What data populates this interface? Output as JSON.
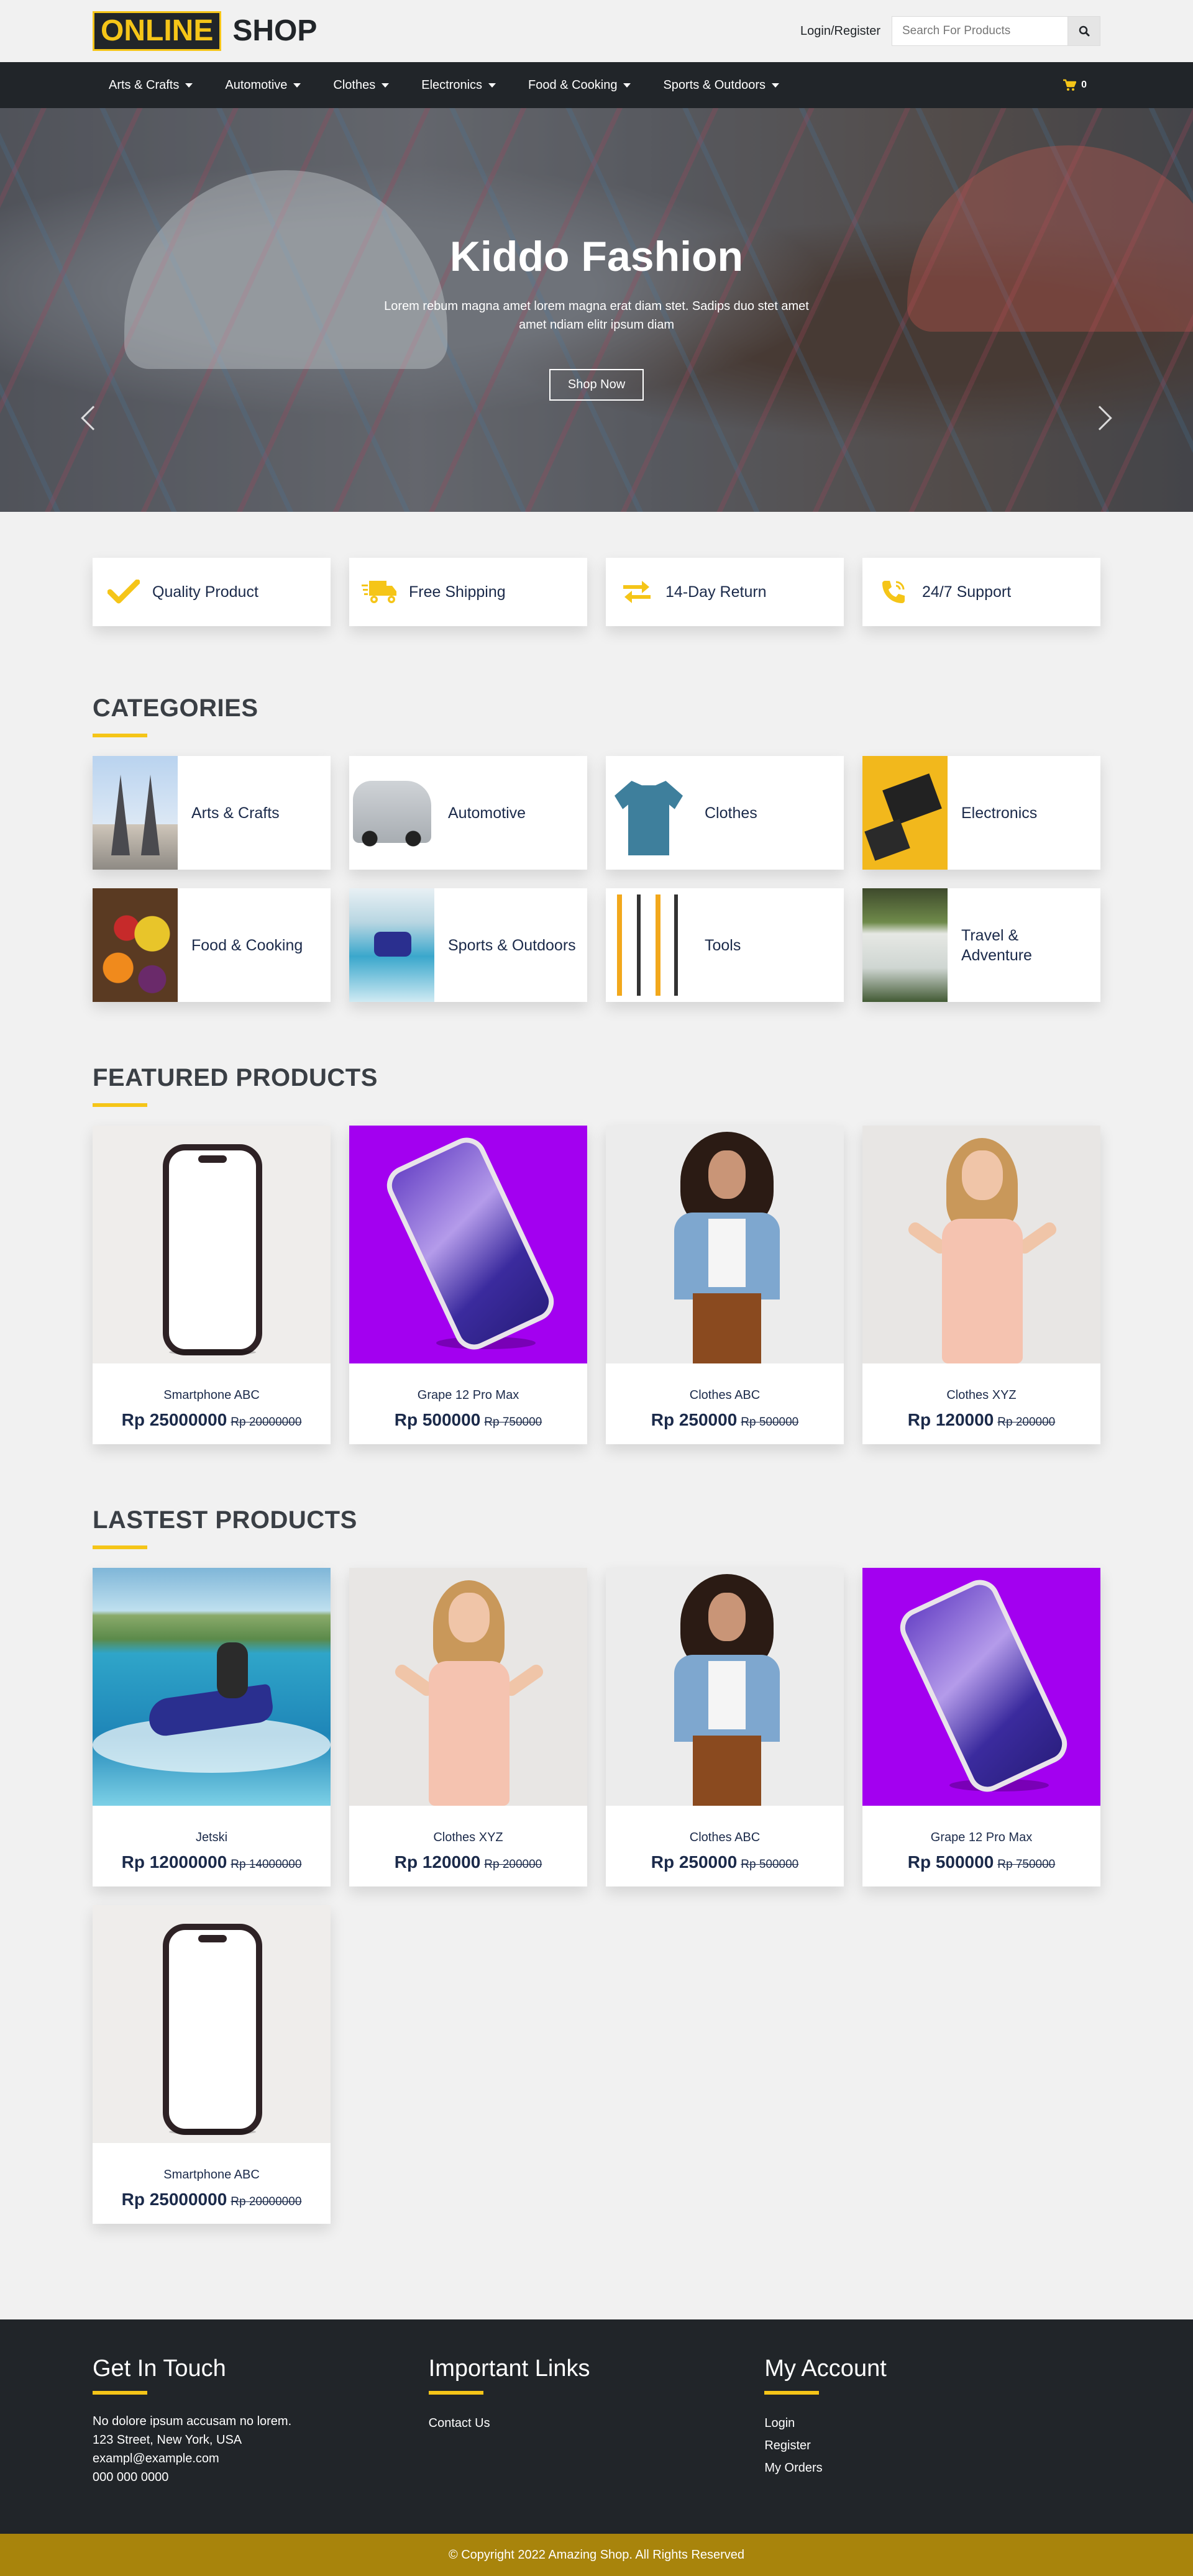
{
  "brand": {
    "part1": "ONLINE",
    "part2": "SHOP"
  },
  "header": {
    "login_label": "Login/Register",
    "search_placeholder": "Search For Products"
  },
  "nav": {
    "items": [
      {
        "label": "Arts & Crafts"
      },
      {
        "label": "Automotive"
      },
      {
        "label": "Clothes"
      },
      {
        "label": "Electronics"
      },
      {
        "label": "Food & Cooking"
      },
      {
        "label": "Sports & Outdoors"
      }
    ],
    "cart_count": "0"
  },
  "hero": {
    "title": "Kiddo Fashion",
    "text": "Lorem rebum magna amet lorem magna erat diam stet. Sadips duo stet amet amet ndiam elitr ipsum diam",
    "button_label": "Shop Now"
  },
  "features": [
    {
      "label": "Quality Product",
      "icon": "check-icon"
    },
    {
      "label": "Free Shipping",
      "icon": "truck-icon"
    },
    {
      "label": "14-Day Return",
      "icon": "exchange-icon"
    },
    {
      "label": "24/7 Support",
      "icon": "phone-icon"
    }
  ],
  "categories": {
    "title": "CATEGORIES",
    "items": [
      {
        "label": "Arts & Crafts"
      },
      {
        "label": "Automotive"
      },
      {
        "label": "Clothes"
      },
      {
        "label": "Electronics"
      },
      {
        "label": "Food & Cooking"
      },
      {
        "label": "Sports & Outdoors"
      },
      {
        "label": "Tools"
      },
      {
        "label": "Travel & Adventure"
      }
    ]
  },
  "featured": {
    "title": "FEATURED PRODUCTS",
    "items": [
      {
        "name": "Smartphone ABC",
        "price": "Rp 25000000",
        "old_price": "Rp 20000000"
      },
      {
        "name": "Grape 12 Pro Max",
        "price": "Rp 500000",
        "old_price": "Rp 750000"
      },
      {
        "name": "Clothes ABC",
        "price": "Rp 250000",
        "old_price": "Rp 500000"
      },
      {
        "name": "Clothes XYZ",
        "price": "Rp 120000",
        "old_price": "Rp 200000"
      }
    ]
  },
  "latest": {
    "title": "LASTEST PRODUCTS",
    "items": [
      {
        "name": "Jetski",
        "price": "Rp 12000000",
        "old_price": "Rp 14000000"
      },
      {
        "name": "Clothes XYZ",
        "price": "Rp 120000",
        "old_price": "Rp 200000"
      },
      {
        "name": "Clothes ABC",
        "price": "Rp 250000",
        "old_price": "Rp 500000"
      },
      {
        "name": "Grape 12 Pro Max",
        "price": "Rp 500000",
        "old_price": "Rp 750000"
      },
      {
        "name": "Smartphone ABC",
        "price": "Rp 25000000",
        "old_price": "Rp 20000000"
      }
    ]
  },
  "footer": {
    "contact": {
      "title": "Get In Touch",
      "lines": [
        "No dolore ipsum accusam no lorem.",
        "123 Street, New York, USA",
        "exampl@example.com",
        "000 000 0000"
      ]
    },
    "links": {
      "title": "Important Links",
      "items": [
        "Contact Us"
      ]
    },
    "account": {
      "title": "My Account",
      "items": [
        "Login",
        "Register",
        "My Orders"
      ]
    },
    "copyright": "© Copyright 2022 Amazing Shop. All Rights Reserved"
  },
  "colors": {
    "accent": "#f5c518",
    "dark": "#212529",
    "copyright_bar": "#a8840c"
  }
}
